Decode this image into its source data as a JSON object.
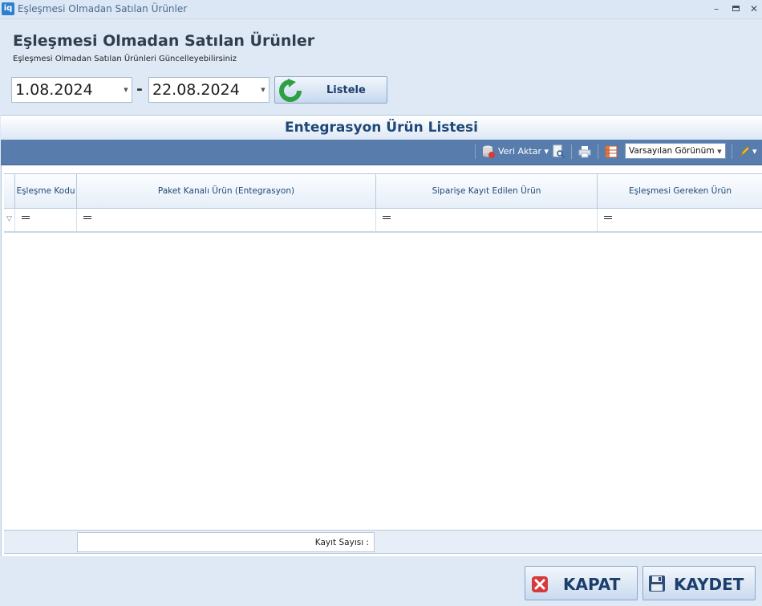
{
  "window": {
    "icon_text": "iq",
    "title": "Eşleşmesi Olmadan Satılan Ürünler",
    "minimize": "–",
    "close": "✕"
  },
  "header": {
    "title": "Eşleşmesi Olmadan Satılan Ürünler",
    "subtitle": "Eşleşmesi Olmadan Satılan Ürünleri Güncelleyebilirsiniz"
  },
  "filters": {
    "start_date": "1.08.2024",
    "separator": "-",
    "end_date": "22.08.2024",
    "list_button": "Listele"
  },
  "group": {
    "title": "Entegrasyon Ürün Listesi"
  },
  "toolbar": {
    "export_label": "Veri Aktar",
    "view_selected": "Varsayılan Görünüm"
  },
  "grid": {
    "columns": [
      "Eşleşme Kodu",
      "Paket Kanalı Ürün (Entegrasyon)",
      "Siparişe Kayıt Edilen Ürün",
      "Eşleşmesi Gereken Ürün"
    ],
    "rows": [],
    "footer_count_label": "Kayıt Sayısı :"
  },
  "actions": {
    "close_label": "KAPAT",
    "save_label": "KAYDET"
  },
  "icons": {
    "app": "app-logo-icon",
    "refresh": "refresh-icon",
    "export": "database-export-icon",
    "preview": "print-preview-icon",
    "print": "printer-icon",
    "columns": "column-chooser-icon",
    "edit": "pencil-icon",
    "filter": "filter-icon",
    "close": "close-icon",
    "save": "floppy-disk-icon"
  }
}
